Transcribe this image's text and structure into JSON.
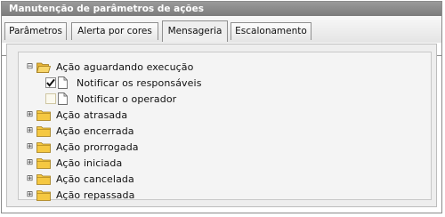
{
  "window": {
    "title": "Manutenção de parâmetros de ações"
  },
  "tabs": [
    {
      "label": "Parâmetros",
      "active": false
    },
    {
      "label": "Alerta por cores",
      "active": false
    },
    {
      "label": "Mensageria",
      "active": true
    },
    {
      "label": "Escalonamento",
      "active": false
    }
  ],
  "tree": {
    "nodes": [
      {
        "label": "Ação aguardando execução",
        "expanded": true,
        "icon": "folder-open-icon",
        "children": [
          {
            "label": "Notificar os responsáveis",
            "checked": true,
            "icon": "document-icon"
          },
          {
            "label": "Notificar o operador",
            "checked": false,
            "icon": "document-icon"
          }
        ]
      },
      {
        "label": "Ação atrasada",
        "expanded": false,
        "icon": "folder-icon"
      },
      {
        "label": "Ação encerrada",
        "expanded": false,
        "icon": "folder-icon"
      },
      {
        "label": "Ação prorrogada",
        "expanded": false,
        "icon": "folder-icon"
      },
      {
        "label": "Ação iniciada",
        "expanded": false,
        "icon": "folder-icon"
      },
      {
        "label": "Ação cancelada",
        "expanded": false,
        "icon": "folder-icon"
      },
      {
        "label": "Ação repassada",
        "expanded": false,
        "icon": "folder-icon"
      }
    ]
  },
  "colors": {
    "titlebar": "#8a8a8a",
    "folder": "#f5c842",
    "check": "#111111"
  }
}
